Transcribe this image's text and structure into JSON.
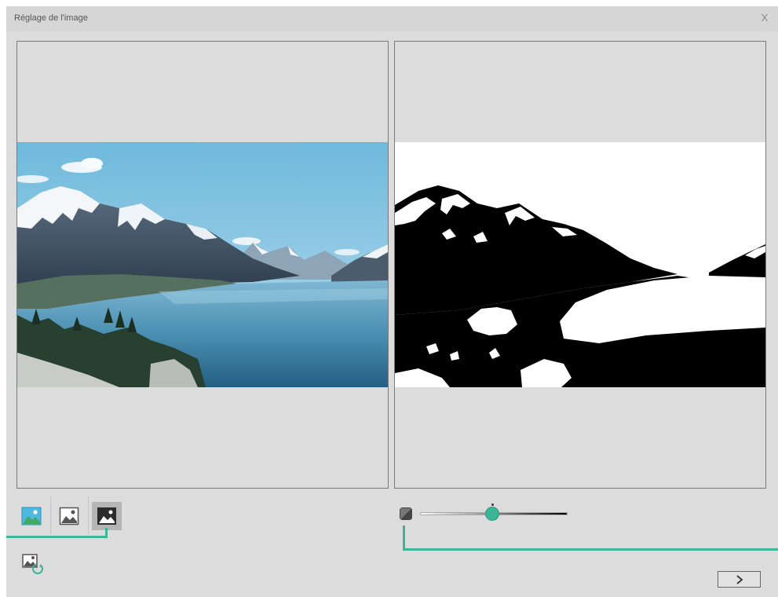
{
  "window": {
    "title": "Réglage de l'image",
    "close_label": "X"
  },
  "panes": {
    "original": {
      "content": "color-landscape-photo"
    },
    "preview": {
      "content": "black-white-threshold-preview"
    }
  },
  "toolbar": {
    "modes": [
      {
        "name": "color-image-icon",
        "selected": false
      },
      {
        "name": "grayscale-image-icon",
        "selected": false
      },
      {
        "name": "black-white-image-icon",
        "selected": true
      }
    ],
    "rotate_icon": "image-rotate-icon"
  },
  "threshold": {
    "icon": "contrast-icon",
    "level": 0.49
  },
  "navigation": {
    "next_icon": "chevron-right-icon"
  },
  "colors": {
    "accent": "#3bb595",
    "dialog_bg": "#dcdcdc",
    "selected_bg": "#b5b5b5"
  }
}
